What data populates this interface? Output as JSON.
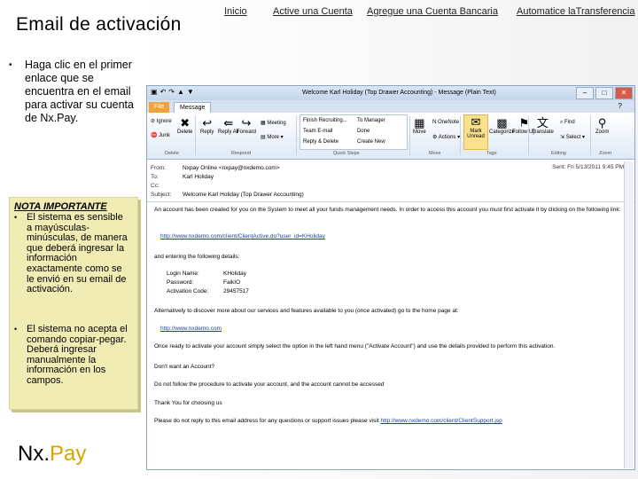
{
  "slide": {
    "title": "Email de activación",
    "intro": "Haga clic en el primer enlace que se encuentra en el email para activar su cuenta de Nx.Pay.",
    "note_title": "NOTA IMPORTANTE",
    "note_bullets": [
      "El sistema es sensible a mayúsculas-minúsculas, de manera que deberá ingresar la información exactamente como se le envió en su email de activación.",
      "El sistema no acepta el comando copiar-pegar. Deberá ingresar manualmente la información en los campos."
    ],
    "logo_nx": "Nx.",
    "logo_pay": "Pay"
  },
  "nav": [
    "Inicio",
    "Active una Cuenta",
    "Agregue una Cuenta Bancaria",
    "Automatice laTransferencia"
  ],
  "outlook": {
    "window_title": "Welcome Karl Holiday (Top Drawer Accounting) - Message (Plain Text)",
    "tabs": [
      "File",
      "Message"
    ],
    "ribbon": {
      "ignore": "Ignore",
      "junk": "Junk",
      "delete": "Delete",
      "reply": "Reply",
      "reply_all": "Reply All",
      "forward": "Forward",
      "meeting": "Meeting",
      "more": "More",
      "quick_steps": [
        "Finish Recruiting...",
        "Team E-mail",
        "Reply & Delete",
        "To Manager",
        "Done",
        "Create New"
      ],
      "move": "Move",
      "onenote": "OneNote",
      "actions": "Actions",
      "mark_unread": "Mark Unread",
      "categorize": "Categorize",
      "follow_up": "Follow Up",
      "translate": "Translate",
      "find": "Find",
      "select": "Select",
      "zoom": "Zoom",
      "groups": [
        "Delete",
        "Respond",
        "Quick Steps",
        "Move",
        "Tags",
        "Editing",
        "Zoom"
      ]
    },
    "header": {
      "from_label": "From:",
      "from": "Nxpay Online <nxpay@nxdemo.com>",
      "to_label": "To:",
      "to": "Karl Holiday",
      "cc_label": "Cc:",
      "cc": "",
      "subject_label": "Subject:",
      "subject": "Welcome Karl Holiday (Top Drawer Accounting)",
      "sent": "Sent: Fri 5/13/2011 9:45 PM"
    },
    "body": {
      "p1": "An account has been created for you on the System to meet all your funds management needs. In order to access this account you must first activate it by clicking on the following link:",
      "link1": "http://www.nxdemo.com/client/ClientActive.do?user_id=KHoliday",
      "p2": "and entering the following details:",
      "login_label": "Login Name:",
      "login": "KHoliday",
      "password_label": "Password:",
      "password": "FaikIO",
      "code_label": "Activation Code:",
      "code": "29457517",
      "p3": "Alternatively to discover more about our services and features available to you (once activated) go to the home page at:",
      "link2": "http://www.nxdemo.com",
      "p4": "Once ready to activate your account simply select the option in the left hand menu (\"Activate Account\") and use the details provided to perform this activation.",
      "p5": "Don't want an Account?",
      "p6": "Do not follow the procedure to activate your account, and the account cannot be accessed",
      "p7": "Thank You for choosing us",
      "p8": "Please do not reply to this email address for any questions or support issues please visit",
      "link3": "http://www.nxdemo.com/client/ClientSupport.jsp"
    }
  }
}
